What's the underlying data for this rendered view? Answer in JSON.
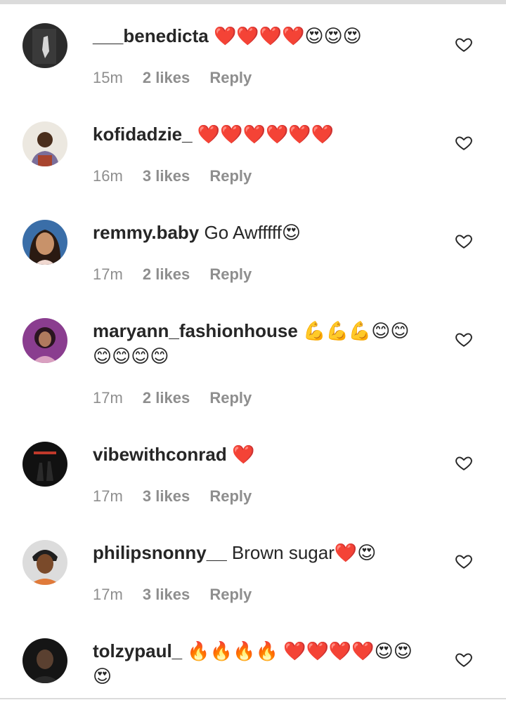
{
  "comments": [
    {
      "username": "___benedicta",
      "text": "❤️❤️❤️❤️😍😍😍",
      "time": "15m",
      "likes": "2 likes",
      "reply": "Reply",
      "avatar_color": "#2b2b2b",
      "avatar_accent": "#cfcfcf"
    },
    {
      "username": "kofidadzie_",
      "text": "❤️❤️❤️❤️❤️❤️",
      "time": "16m",
      "likes": "3 likes",
      "reply": "Reply",
      "avatar_color": "#e8e4dc",
      "avatar_accent": "#6b4a2e"
    },
    {
      "username": "remmy.baby",
      "text": "Go Awfffff😍",
      "time": "17m",
      "likes": "2 likes",
      "reply": "Reply",
      "avatar_color": "#3a6ea8",
      "avatar_accent": "#c8926a"
    },
    {
      "username": "maryann_fashionhouse",
      "text": "💪💪💪😊😊😊😊😊😊",
      "time": "17m",
      "likes": "2 likes",
      "reply": "Reply",
      "avatar_color": "#8a3d8f",
      "avatar_accent": "#d9a0c0"
    },
    {
      "username": "vibewithconrad",
      "text": "❤️",
      "time": "17m",
      "likes": "3 likes",
      "reply": "Reply",
      "avatar_color": "#111111",
      "avatar_accent": "#c0392b"
    },
    {
      "username": "philipsnonny__",
      "text": "Brown sugar❤️😍",
      "time": "17m",
      "likes": "3 likes",
      "reply": "Reply",
      "avatar_color": "#d8d8d8",
      "avatar_accent": "#7a4a2a"
    },
    {
      "username": "tolzypaul_",
      "text": "🔥🔥🔥🔥 ❤️❤️❤️❤️😍😍😍",
      "time": "",
      "likes": "",
      "reply": "",
      "avatar_color": "#151515",
      "avatar_accent": "#5a4030"
    }
  ],
  "colors": {
    "meta": "#8e8e8e",
    "divider": "#dbdbdb",
    "heart_outline": "#262626"
  },
  "icons": {
    "like": "heart-outline-icon"
  }
}
